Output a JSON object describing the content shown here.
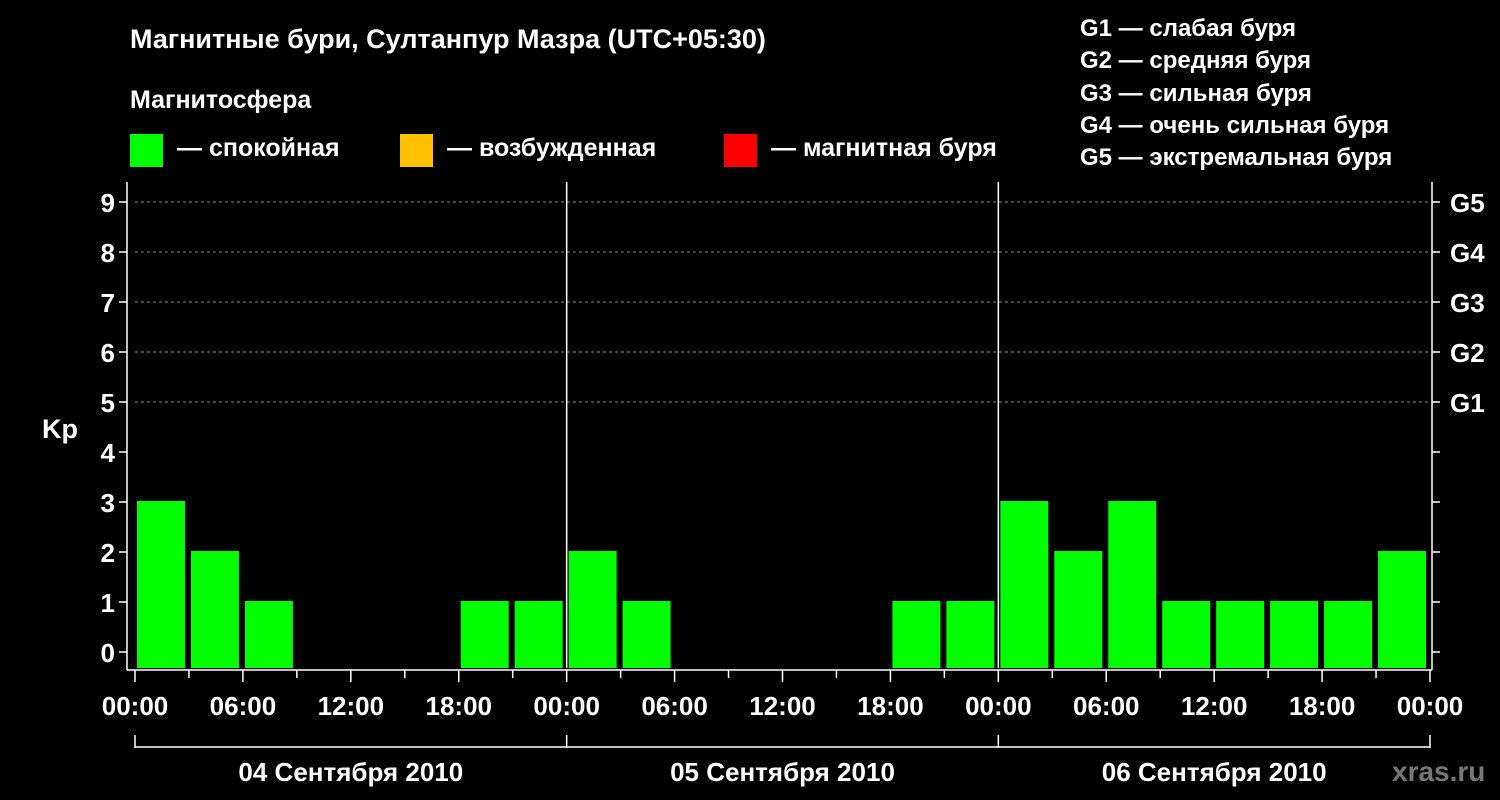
{
  "title": "Магнитные бури, Султанпур Мазра (UTC+05:30)",
  "magnetosphere_label": "Магнитосфера",
  "state_legend": [
    {
      "label": "— спокойная",
      "color": "#00ff00"
    },
    {
      "label": "— возбужденная",
      "color": "#ffc000"
    },
    {
      "label": "— магнитная буря",
      "color": "#ff0000"
    }
  ],
  "g_legend": [
    "G1 — слабая буря",
    "G2 — средняя буря",
    "G3 — сильная буря",
    "G4 — очень сильная буря",
    "G5 — экстремальная буря"
  ],
  "watermark": "xras.ru",
  "chart_data": {
    "type": "bar",
    "ylabel": "Kp",
    "ylim": [
      0,
      9
    ],
    "y_ticks": [
      "0",
      "1",
      "2",
      "3",
      "4",
      "5",
      "6",
      "7",
      "8",
      "9"
    ],
    "g_levels": [
      {
        "label": "G1",
        "kp": 5
      },
      {
        "label": "G2",
        "kp": 6
      },
      {
        "label": "G3",
        "kp": 7
      },
      {
        "label": "G4",
        "kp": 8
      },
      {
        "label": "G5",
        "kp": 9
      }
    ],
    "x_tick_labels": [
      "00:00",
      "06:00",
      "12:00",
      "18:00",
      "00:00",
      "06:00",
      "12:00",
      "18:00",
      "00:00",
      "06:00",
      "12:00",
      "18:00",
      "00:00"
    ],
    "days": [
      "04 Сентября 2010",
      "05 Сентября 2010",
      "06 Сентября 2010"
    ],
    "grid": "dashed horizontal at Kp 5-9",
    "color": "#00ff00",
    "values": [
      3,
      2,
      1,
      0,
      0,
      0,
      1,
      1,
      2,
      1,
      0,
      0,
      0,
      0,
      1,
      1,
      3,
      2,
      3,
      1,
      1,
      1,
      1,
      2
    ]
  }
}
